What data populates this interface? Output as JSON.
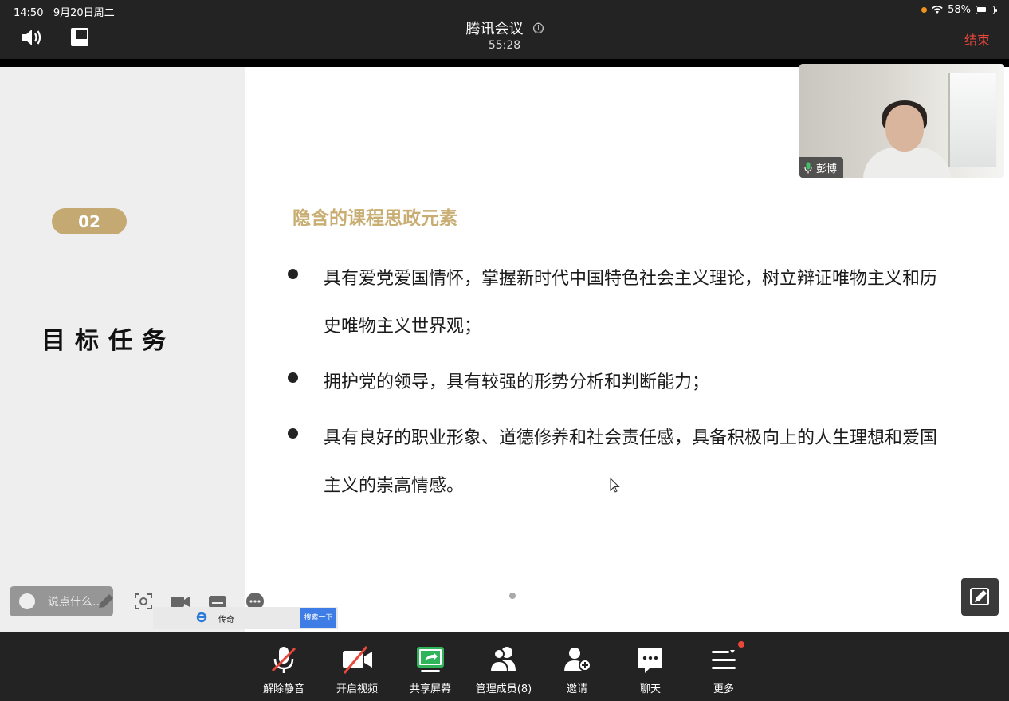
{
  "status_bar": {
    "time": "14:50",
    "date": "9月20日周二",
    "battery": "58%",
    "battery_level": 0.58
  },
  "top_bar": {
    "title": "腾讯会议",
    "info_icon": "ⓘ",
    "timer": "55:28",
    "end_label": "结束",
    "speaker_icon": "speaker-icon",
    "layout_icon": "layout-icon"
  },
  "slide": {
    "section_number": "02",
    "section_title": "目标任务",
    "heading": "隐含的课程思政元素",
    "bullets": [
      "具有爱党爱国情怀，掌握新时代中国特色社会主义理论，树立辩证唯物主义和历史唯物主义世界观；",
      "拥护党的领导，具有较强的形势分析和判断能力；",
      "具有良好的职业形象、道德修养和社会责任感，具备积极向上的人生理想和爱国主义的崇高情感。"
    ]
  },
  "video_tile": {
    "participant_name": "彭博"
  },
  "float_toolbar": {
    "chat_placeholder": "说点什么...",
    "ie_label": "传奇",
    "search_button": "搜索一下"
  },
  "bottom_bar": {
    "items": [
      {
        "label": "解除静音",
        "icon": "mic-muted-icon"
      },
      {
        "label": "开启视频",
        "icon": "camera-off-icon"
      },
      {
        "label": "共享屏幕",
        "icon": "share-screen-icon"
      },
      {
        "label": "管理成员(8)",
        "icon": "members-icon"
      },
      {
        "label": "邀请",
        "icon": "invite-icon"
      },
      {
        "label": "聊天",
        "icon": "chat-icon"
      },
      {
        "label": "更多",
        "icon": "more-icon"
      }
    ]
  },
  "colors": {
    "end_red": "#e8473a",
    "share_green": "#2fb45a",
    "heading_gold": "#c9ae74",
    "badge_gold": "#c4aa72"
  }
}
